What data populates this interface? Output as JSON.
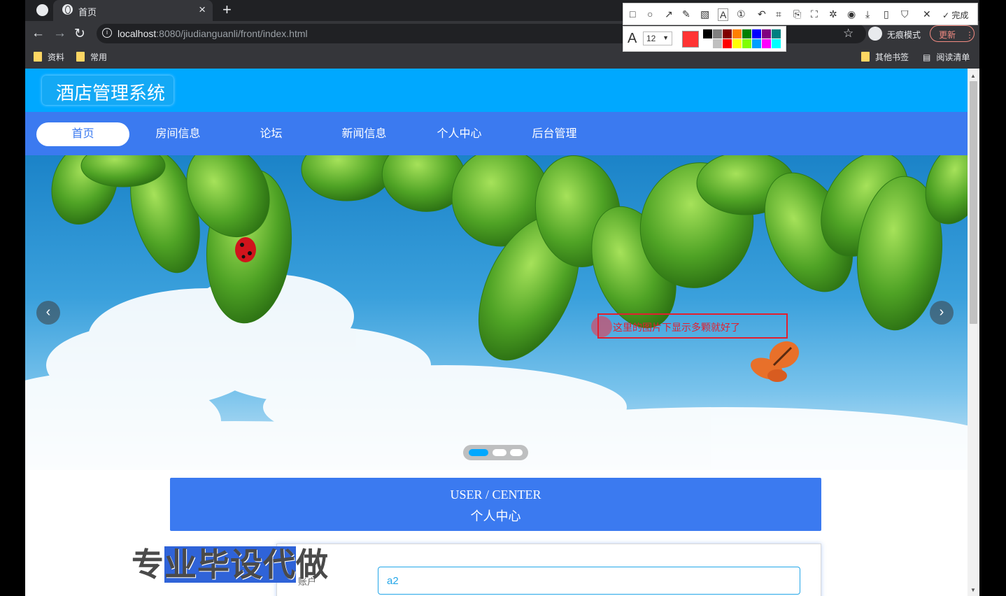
{
  "browser": {
    "tab_title": "首页",
    "tab_close": "×",
    "new_tab": "+",
    "url_host": "localhost",
    "url_rest": ":8080/jiudianguanli/front/index.html",
    "incognito_label": "无痕模式",
    "update_label": "更新",
    "update_menu": "⋮",
    "bookmarks": [
      "资料",
      "常用"
    ],
    "bookmarks_right": [
      "其他书签",
      "阅读清单"
    ]
  },
  "annotation_toolbar": {
    "done_label": "完成",
    "font_size": "12",
    "swatches": [
      "#000000",
      "#808080",
      "#800000",
      "#ff8000",
      "#008000",
      "#0000ff",
      "#800080",
      "#008080",
      "#ffffff",
      "#c0c0c0",
      "#ff0000",
      "#ffff00",
      "#80ff00",
      "#00a0ff",
      "#ff00ff",
      "#00ffff"
    ],
    "current_color": "#ff3333"
  },
  "site": {
    "logo": "酒店管理系统",
    "nav": [
      "首页",
      "房间信息",
      "论坛",
      "新闻信息",
      "个人中心",
      "后台管理"
    ],
    "banner_prev": "‹",
    "banner_next": "›",
    "banner_annotation": "这里的图片下显示多颗就好了",
    "center_title_en": "USER / CENTER",
    "center_title_cn": "个人中心",
    "form_label_account": "账户",
    "form_value_account": "a2",
    "watermark_text_a": "专",
    "watermark_text_b": "业毕设代",
    "watermark_text_c": "做"
  }
}
